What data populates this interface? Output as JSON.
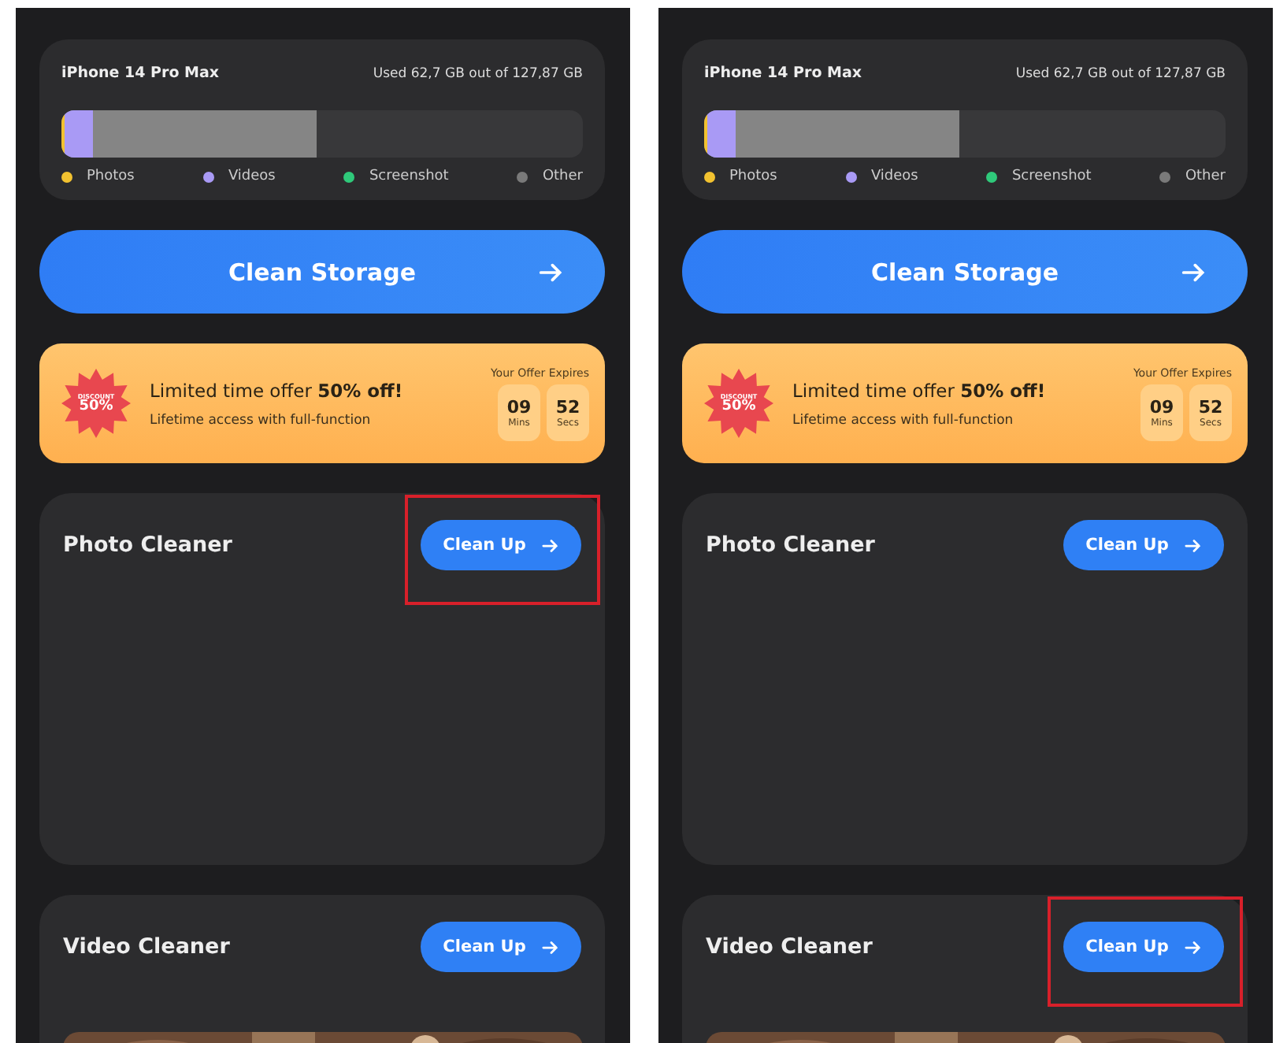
{
  "screens": [
    {
      "device": "iPhone 14 Pro Max",
      "usage": "Used 62,7 GB out of 127,87 GB",
      "storage_bar": {
        "level": 0.49,
        "color": "#858585",
        "parts": [
          {
            "color": "#f2c230",
            "level": 0.012
          },
          {
            "color": "#a99af5",
            "level": 0.11
          }
        ]
      },
      "legend": [
        {
          "label": "Photos",
          "color": "#f2c230"
        },
        {
          "label": "Videos",
          "color": "#a99af5"
        },
        {
          "label": "Screenshot",
          "color": "#2fc97a"
        },
        {
          "label": "Other",
          "color": "#7a7a7a"
        }
      ],
      "clean_button": "Clean Storage",
      "offer": {
        "badge_top": "DISCOUNT",
        "badge_value": "50%",
        "headline": "Limited time offer **50% off!**",
        "subline": "Lifetime access with full-function",
        "expires_label": "Your Offer Expires",
        "timer": [
          {
            "value": "09",
            "unit": "Mins"
          },
          {
            "value": "52",
            "unit": "Secs"
          }
        ]
      },
      "cleaners": [
        {
          "title": "Photo Cleaner",
          "button": "Clean Up",
          "highlighted": true
        },
        {
          "kind": "video",
          "title": "Video Cleaner",
          "button": "Clean Up",
          "highlighted": false
        }
      ]
    },
    {
      "device": "iPhone 14 Pro Max",
      "usage": "Used 62,7 GB out of 127,87 GB",
      "storage_bar": {
        "level": 0.49,
        "color": "#858585",
        "parts": [
          {
            "color": "#f2c230",
            "level": 0.012
          },
          {
            "color": "#a99af5",
            "level": 0.11
          }
        ]
      },
      "legend": [
        {
          "label": "Photos",
          "color": "#f2c230"
        },
        {
          "label": "Videos",
          "color": "#a99af5"
        },
        {
          "label": "Screenshot",
          "color": "#2fc97a"
        },
        {
          "label": "Other",
          "color": "#7a7a7a"
        }
      ],
      "clean_button": "Clean Storage",
      "offer": {
        "badge_top": "DISCOUNT",
        "badge_value": "50%",
        "headline": "Limited time offer **50% off!**",
        "subline": "Lifetime access with full-function",
        "expires_label": "Your Offer Expires",
        "timer": [
          {
            "value": "09",
            "unit": "Mins"
          },
          {
            "value": "52",
            "unit": "Secs"
          }
        ]
      },
      "cleaners": [
        {
          "title": "Photo Cleaner",
          "button": "Clean Up",
          "highlighted": false
        },
        {
          "kind": "video",
          "title": "Video Cleaner",
          "button": "Clean Up",
          "highlighted": true
        }
      ]
    }
  ]
}
